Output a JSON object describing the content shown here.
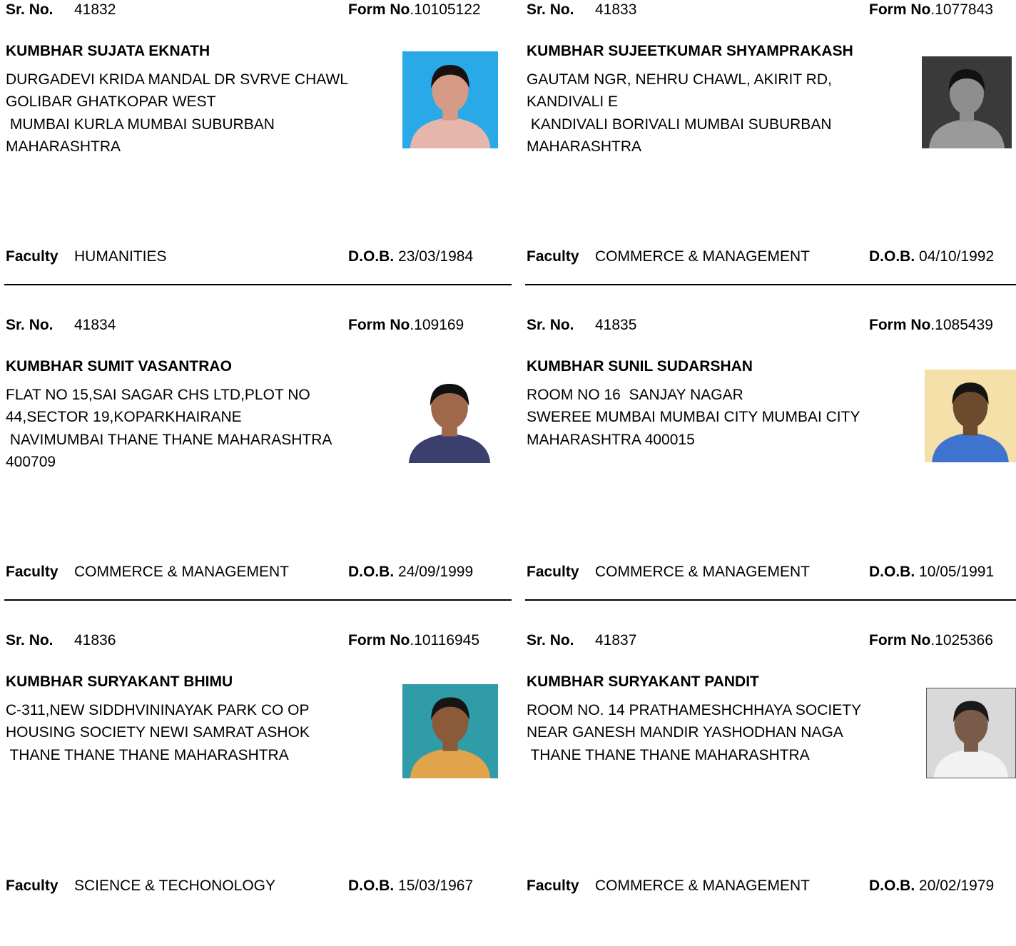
{
  "labels": {
    "sr_no": "Sr. No.",
    "form_no": "Form No",
    "faculty": "Faculty",
    "dob": "D.O.B."
  },
  "records": [
    {
      "sr_no": "41832",
      "form_no": ".10105122",
      "name": "KUMBHAR SUJATA EKNATH",
      "address": [
        "DURGADEVI KRIDA MANDAL DR SVRVE CHAWL",
        "GOLIBAR GHATKOPAR WEST",
        " MUMBAI KURLA MUMBAI SUBURBAN",
        "MAHARASHTRA"
      ],
      "faculty": "HUMANITIES",
      "dob": "23/03/1984",
      "photo": {
        "background": "#2aa9e8",
        "skin": "#d69b86",
        "hair": "#1a1010",
        "shirt": "#e6b6ab"
      }
    },
    {
      "sr_no": "41833",
      "form_no": ".1077843",
      "name": "KUMBHAR SUJEETKUMAR SHYAMPRAKASH",
      "address": [
        "GAUTAM NGR, NEHRU CHAWL, AKIRIT RD,",
        "KANDIVALI E",
        " KANDIVALI BORIVALI MUMBAI SUBURBAN",
        "MAHARASHTRA"
      ],
      "faculty": "COMMERCE & MANAGEMENT",
      "dob": "04/10/1992",
      "photo": {
        "background": "#3a3a3a",
        "skin": "#8e8e8e",
        "hair": "#111111",
        "shirt": "#9a9a9a"
      }
    },
    {
      "sr_no": "41834",
      "form_no": ".109169",
      "name": "KUMBHAR SUMIT VASANTRAO",
      "address": [
        "FLAT NO 15,SAI SAGAR CHS LTD,PLOT NO",
        "44,SECTOR 19,KOPARKHAIRANE",
        " NAVIMUMBAI THANE THANE MAHARASHTRA",
        "400709"
      ],
      "faculty": "COMMERCE & MANAGEMENT",
      "dob": "24/09/1999",
      "photo": {
        "background": "#ffffff",
        "skin": "#a0684a",
        "hair": "#101010",
        "shirt": "#3b3f6e"
      }
    },
    {
      "sr_no": "41835",
      "form_no": ".1085439",
      "name": "KUMBHAR SUNIL SUDARSHAN",
      "address": [
        "ROOM NO 16  SANJAY NAGAR",
        "SWEREE MUMBAI MUMBAI CITY MUMBAI CITY",
        "MAHARASHTRA 400015"
      ],
      "faculty": "COMMERCE & MANAGEMENT",
      "dob": "10/05/1991",
      "photo": {
        "background": "#f4e0a8",
        "skin": "#6b4a2e",
        "hair": "#141414",
        "shirt": "#3e74d0"
      }
    },
    {
      "sr_no": "41836",
      "form_no": ".10116945",
      "name": "KUMBHAR SURYAKANT BHIMU",
      "address": [
        "C-311,NEW SIDDHVININAYAK PARK CO OP",
        "HOUSING SOCIETY NEWI SAMRAT ASHOK",
        " THANE THANE THANE MAHARASHTRA"
      ],
      "faculty": "SCIENCE & TECHONOLOGY",
      "dob": "15/03/1967",
      "photo": {
        "background": "#2f9ca7",
        "skin": "#8a5a3a",
        "hair": "#151515",
        "shirt": "#e0a54c"
      }
    },
    {
      "sr_no": "41837",
      "form_no": ".1025366",
      "name": "KUMBHAR SURYAKANT PANDIT",
      "address": [
        "ROOM NO. 14 PRATHAMESHCHHAYA SOCIETY",
        "NEAR GANESH MANDIR YASHODHAN NAGA",
        " THANE THANE THANE MAHARASHTRA"
      ],
      "faculty": "COMMERCE & MANAGEMENT",
      "dob": "20/02/1979",
      "photo": {
        "background": "#d9d9d9",
        "skin": "#7a5a48",
        "hair": "#1a1a1a",
        "shirt": "#f2f2f2"
      }
    }
  ]
}
